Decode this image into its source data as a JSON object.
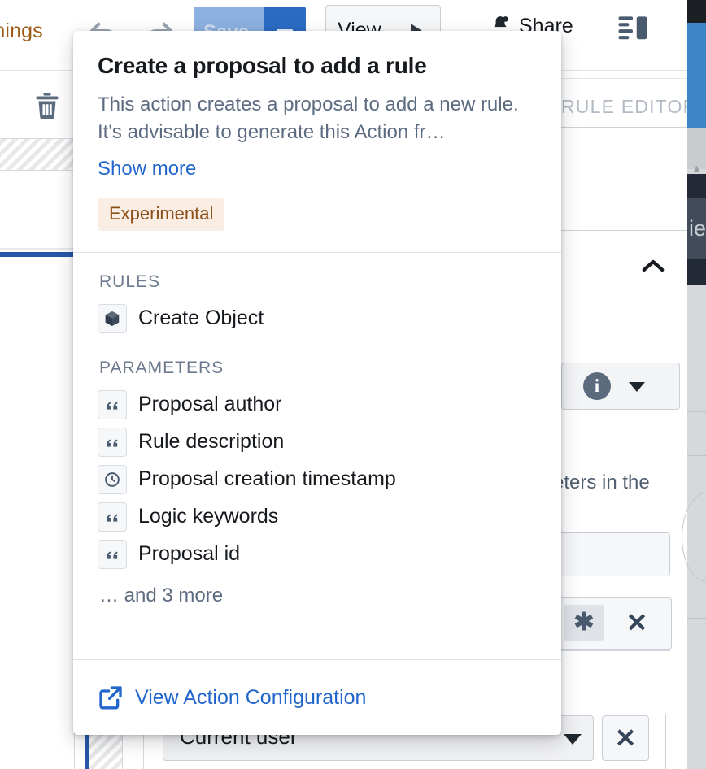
{
  "background": {
    "toolbar": {
      "warnings_fragment": "rnings",
      "undo_icon": "undo-arrow-icon",
      "redo_icon": "redo-arrow-icon",
      "save_label": "Save",
      "save_caret_icon": "chevron-down-icon",
      "view_label": "View",
      "view_play_icon": "play-icon",
      "share_label": "Share",
      "share_icon": "notification-bell-icon",
      "panel_toggle_icon": "side-panel-icon"
    },
    "left_rail": {
      "delete_icon": "trash-icon"
    },
    "right_pane": {
      "section_label": "RULE EDITOR",
      "collapse_icon": "chevron-up-icon",
      "info_icon": "info-circle-icon",
      "info_caret_icon": "chevron-down-icon",
      "text_fragment": "eters in the",
      "asterisk_label": "✱",
      "clear_label": "✕"
    },
    "bottom_row": {
      "select_value": "Current user",
      "select_caret_icon": "chevron-down-icon",
      "clear_label": "✕"
    },
    "edge_strip": {
      "label_fragment": "ie"
    },
    "colors": {
      "accent_blue": "#2266cc",
      "save_blue": "#2a6cc4",
      "warning_brown": "#9c5a15",
      "tag_bg": "#faeee4",
      "tag_text": "#8a4f1a",
      "muted_text": "#5c6b80",
      "rail_blue": "#2657a8"
    }
  },
  "popover": {
    "title": "Create a proposal to add a rule",
    "description": "This action creates a proposal to add a new rule. It's advisable to generate this Action fr…",
    "show_more_label": "Show more",
    "tag": "Experimental",
    "rules_label": "RULES",
    "rules": [
      {
        "label": "Create Object",
        "icon": "cube-object-icon"
      }
    ],
    "parameters_label": "PARAMETERS",
    "parameters": [
      {
        "label": "Proposal author",
        "icon": "string-quote-icon"
      },
      {
        "label": "Rule description",
        "icon": "string-quote-icon"
      },
      {
        "label": "Proposal creation timestamp",
        "icon": "clock-timestamp-icon"
      },
      {
        "label": "Logic keywords",
        "icon": "string-quote-icon"
      },
      {
        "label": "Proposal id",
        "icon": "string-quote-icon"
      }
    ],
    "more_label": "… and 3 more",
    "footer_link_label": "View Action Configuration",
    "footer_link_icon": "external-link-icon"
  }
}
